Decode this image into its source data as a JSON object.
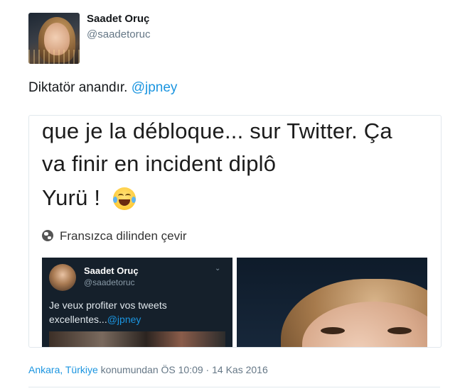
{
  "user": {
    "display_name": "Saadet Oruç",
    "handle": "@saadetoruc"
  },
  "tweet": {
    "text": "Diktatör anandır. ",
    "mention": "@jpney"
  },
  "media": {
    "lines": [
      "que je la débloque... sur Twitter. Ça",
      "va finir en incident diplô",
      "Yurü !"
    ],
    "emoji": "face-with-tears-of-joy",
    "translate_label": "Fransızca dilinden çevir",
    "inner_tweet": {
      "display_name": "Saadet Oruç",
      "handle": "@saadetoruc",
      "text": "Je veux profiter vos tweets excellentes...",
      "mention": "@jpney"
    }
  },
  "footer": {
    "location": "Ankara, Türkiye",
    "suffix": " konumundan ÖS 10:09 · 14 Kas 2016"
  },
  "colors": {
    "link": "#1b95e0",
    "secondary_text": "#657786",
    "inner_background": "#15202b"
  }
}
